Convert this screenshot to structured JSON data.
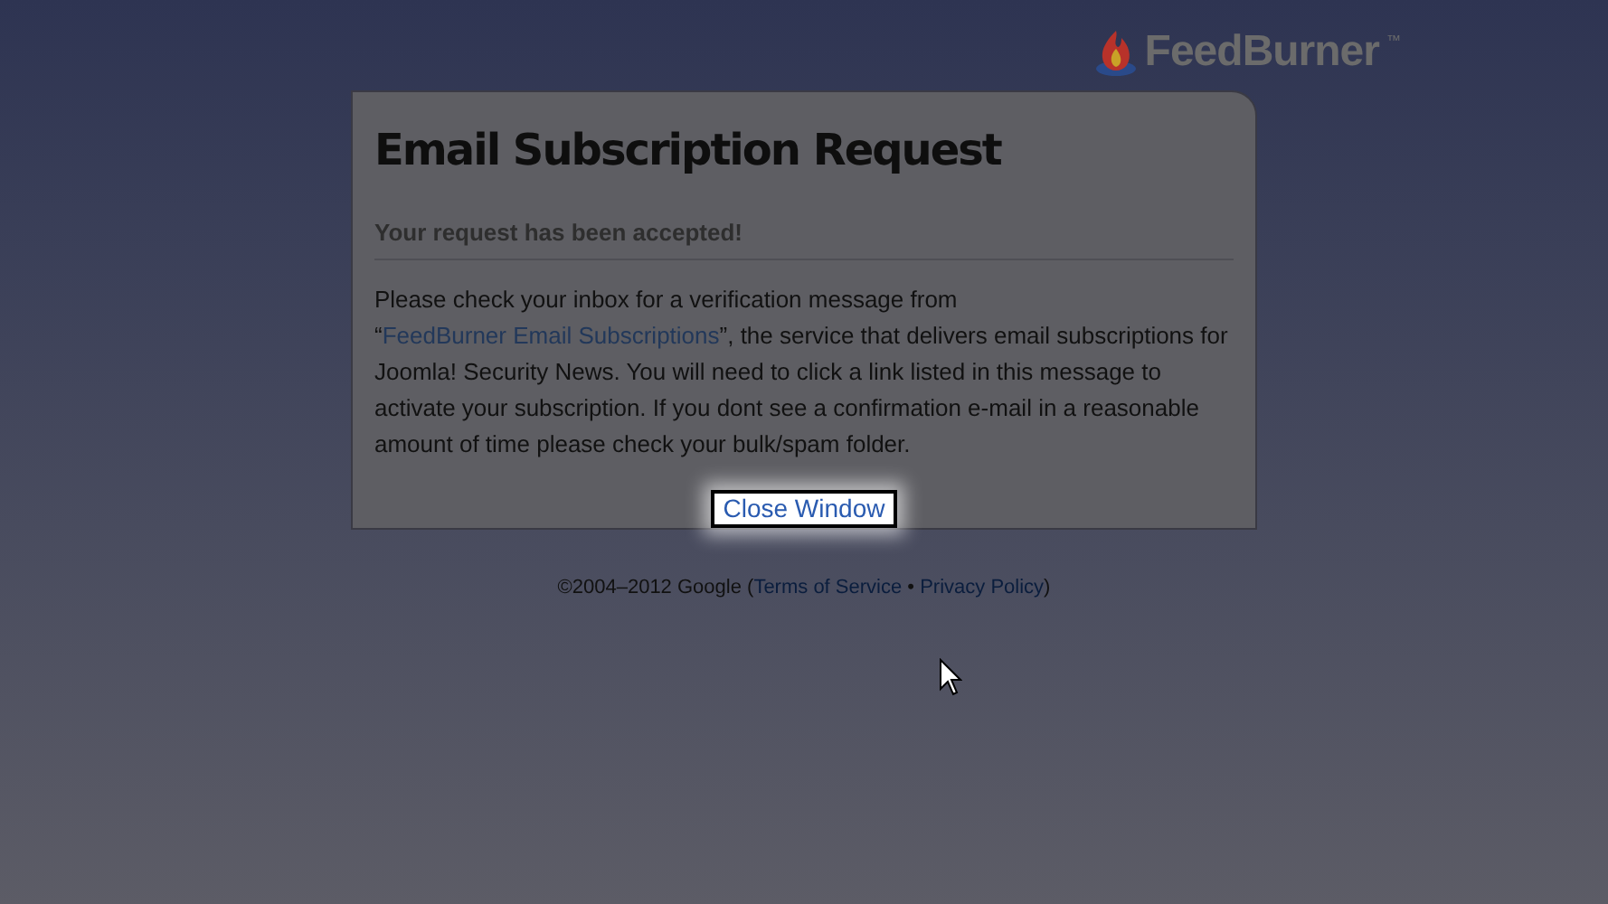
{
  "logo": {
    "text": "FeedBurner",
    "trademark": "™"
  },
  "dialog": {
    "title": "Email Subscription Request",
    "status": "Your request has been accepted!",
    "message": {
      "before": "Please check your inbox for a verification message from “",
      "link": "FeedBurner Email Subscriptions",
      "after": "”, the service that delivers email subscriptions for Joomla! Security News. You will need to click a link listed in this message to activate your subscription. If you dont see a confirmation e-mail in a reasonable amount of time please check your bulk/spam folder."
    },
    "close_link": "Close Window"
  },
  "footer": {
    "copyright": "©2004–2012 Google (",
    "terms": "Terms of Service",
    "separator": " • ",
    "privacy": "Privacy Policy",
    "end": ")"
  }
}
